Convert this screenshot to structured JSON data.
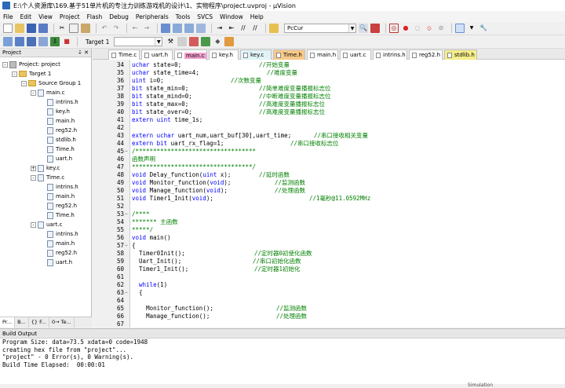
{
  "window": {
    "title": "E:\\个人资源库\\169.基于51单片机的专注力训练游戏机的设计\\1、实物程序\\project.uvproj - µVision"
  },
  "menu": [
    "File",
    "Edit",
    "View",
    "Project",
    "Flash",
    "Debug",
    "Peripherals",
    "Tools",
    "SVCS",
    "Window",
    "Help"
  ],
  "toolbar": {
    "find_combo": "PcCur",
    "target_label": "Target 1"
  },
  "project_panel": {
    "title": "Project",
    "tree": [
      {
        "label": "Project: project",
        "type": "project",
        "indent": 0,
        "toggle": "-"
      },
      {
        "label": "Target 1",
        "type": "folder",
        "indent": 1,
        "toggle": "-"
      },
      {
        "label": "Source Group 1",
        "type": "folder",
        "indent": 2,
        "toggle": "-"
      },
      {
        "label": "main.c",
        "type": "file",
        "indent": 3,
        "toggle": "-"
      },
      {
        "label": "intrins.h",
        "type": "file",
        "indent": 4,
        "toggle": ""
      },
      {
        "label": "key.h",
        "type": "file",
        "indent": 4,
        "toggle": ""
      },
      {
        "label": "main.h",
        "type": "file",
        "indent": 4,
        "toggle": ""
      },
      {
        "label": "reg52.h",
        "type": "file",
        "indent": 4,
        "toggle": ""
      },
      {
        "label": "stdlib.h",
        "type": "file",
        "indent": 4,
        "toggle": ""
      },
      {
        "label": "Time.h",
        "type": "file",
        "indent": 4,
        "toggle": ""
      },
      {
        "label": "uart.h",
        "type": "file",
        "indent": 4,
        "toggle": ""
      },
      {
        "label": "key.c",
        "type": "file",
        "indent": 3,
        "toggle": "+"
      },
      {
        "label": "Time.c",
        "type": "file",
        "indent": 3,
        "toggle": "-"
      },
      {
        "label": "intrins.h",
        "type": "file",
        "indent": 4,
        "toggle": ""
      },
      {
        "label": "main.h",
        "type": "file",
        "indent": 4,
        "toggle": ""
      },
      {
        "label": "reg52.h",
        "type": "file",
        "indent": 4,
        "toggle": ""
      },
      {
        "label": "Time.h",
        "type": "file",
        "indent": 4,
        "toggle": ""
      },
      {
        "label": "uart.c",
        "type": "file",
        "indent": 3,
        "toggle": "-"
      },
      {
        "label": "intrins.h",
        "type": "file",
        "indent": 4,
        "toggle": ""
      },
      {
        "label": "main.h",
        "type": "file",
        "indent": 4,
        "toggle": ""
      },
      {
        "label": "reg52.h",
        "type": "file",
        "indent": 4,
        "toggle": ""
      },
      {
        "label": "uart.h",
        "type": "file",
        "indent": 4,
        "toggle": ""
      }
    ],
    "tabs": [
      "Pr...",
      "B...",
      "{} F...",
      "0→ Te..."
    ]
  },
  "editor": {
    "tabs": [
      "Time.c",
      "uart.h",
      "main.c",
      "key.h",
      "key.c",
      "Time.h",
      "main.h",
      "uart.c",
      "intrins.h",
      "reg52.h",
      "stdlib.h"
    ],
    "active_tab": "main.c",
    "lines": [
      {
        "n": "34",
        "code": "uchar state=0;",
        "comment": "//开始变量",
        "fold": ""
      },
      {
        "n": "35",
        "code": "uchar state_time=4;",
        "comment": "//难度变量",
        "fold": ""
      },
      {
        "n": "36",
        "code": "uint i=0;",
        "comment": "//次数变量",
        "fold": ""
      },
      {
        "n": "37",
        "code": "bit state_min=0;",
        "comment": "//简单难度变量播报标志位",
        "fold": ""
      },
      {
        "n": "38",
        "code": "bit state_mind=0;",
        "comment": "//中断难度变量播报标志位",
        "fold": ""
      },
      {
        "n": "39",
        "code": "bit state_max=0;",
        "comment": "//高难度变量播报标志位",
        "fold": ""
      },
      {
        "n": "40",
        "code": "bit state_over=0;",
        "comment": "//高难度变量播报标志位",
        "fold": ""
      },
      {
        "n": "41",
        "code": "extern uint time_1s;",
        "comment": "",
        "fold": ""
      },
      {
        "n": "42",
        "code": "",
        "comment": "",
        "fold": ""
      },
      {
        "n": "43",
        "code": "extern uchar uart_num,uart_buf[30],uart_time;",
        "comment": "//串口接收相关变量",
        "fold": ""
      },
      {
        "n": "44",
        "code": "extern bit uart_rx_flag=1;",
        "comment": "//串口接收标志位",
        "fold": ""
      },
      {
        "n": "45",
        "code": "",
        "comment": "/**********************************",
        "fold": "−"
      },
      {
        "n": "46",
        "code": "",
        "comment": "函数声明",
        "fold": ""
      },
      {
        "n": "47",
        "code": "",
        "comment": "**********************************/",
        "fold": ""
      },
      {
        "n": "48",
        "code": "void Delay_function(uint x);",
        "comment": "//延时函数",
        "fold": ""
      },
      {
        "n": "49",
        "code": "void Monitor_function(void);",
        "comment": "//监测函数",
        "fold": ""
      },
      {
        "n": "50",
        "code": "void Manage_function(void);",
        "comment": "//处理函数",
        "fold": ""
      },
      {
        "n": "51",
        "code": "void Timer1_Init(void);",
        "comment": "//1毫秒@11.0592MHz",
        "fold": ""
      },
      {
        "n": "52",
        "code": "",
        "comment": "",
        "fold": ""
      },
      {
        "n": "53",
        "code": "",
        "comment": "/****",
        "fold": "−"
      },
      {
        "n": "54",
        "code": "",
        "comment": "******* 主函数",
        "fold": ""
      },
      {
        "n": "55",
        "code": "",
        "comment": "*****/",
        "fold": ""
      },
      {
        "n": "56",
        "code": "void main()",
        "comment": "",
        "fold": ""
      },
      {
        "n": "57",
        "code": "{",
        "comment": "",
        "fold": "−"
      },
      {
        "n": "58",
        "code": "  Timer0Init();",
        "comment": "//定时器0初使化函数",
        "fold": ""
      },
      {
        "n": "59",
        "code": "  Uart_Init();",
        "comment": "//串口初始化函数",
        "fold": ""
      },
      {
        "n": "60",
        "code": "  Timer1_Init();",
        "comment": "//定时器1初始化",
        "fold": ""
      },
      {
        "n": "61",
        "code": "",
        "comment": "",
        "fold": ""
      },
      {
        "n": "62",
        "code": "  while(1)",
        "comment": "",
        "fold": ""
      },
      {
        "n": "63",
        "code": "  {",
        "comment": "",
        "fold": "−"
      },
      {
        "n": "64",
        "code": "",
        "comment": "",
        "fold": ""
      },
      {
        "n": "65",
        "code": "    Monitor_function();",
        "comment": "//监测函数",
        "fold": ""
      },
      {
        "n": "66",
        "code": "    Manage_function();",
        "comment": "//处理函数",
        "fold": ""
      },
      {
        "n": "67",
        "code": "",
        "comment": "",
        "fold": ""
      }
    ]
  },
  "build_output": {
    "title": "Build Output",
    "lines": [
      "Program Size: data=73.5 xdata=0 code=1948",
      "creating hex file from \"project\"...",
      "\"project\" - 0 Error(s), 0 Warning(s).",
      "Build Time Elapsed:  00:00:01"
    ]
  },
  "status_bar": {
    "mode": "Simulation"
  },
  "colors": {
    "keyword": "#0000ff",
    "comment": "#008000",
    "active_tab": "#f2a0cf"
  }
}
